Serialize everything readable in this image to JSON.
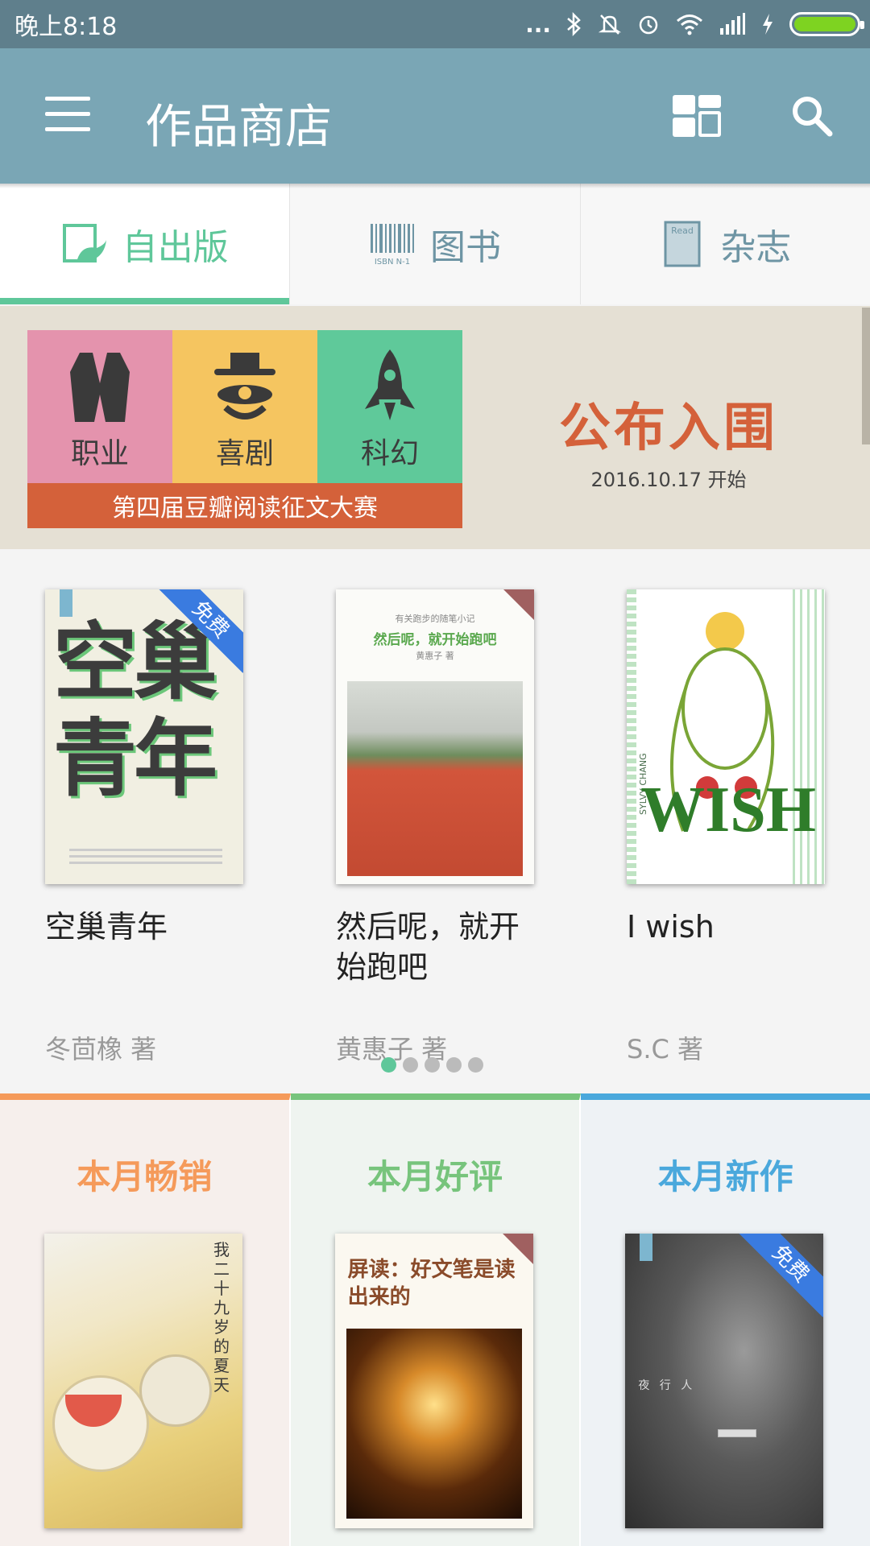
{
  "status_bar": {
    "time": "晚上8:18",
    "dots": "...",
    "wifi_icon": "wifi-icon",
    "battery_color": "#7ed321"
  },
  "app_bar": {
    "title": "作品商店",
    "menu_icon": "menu-icon",
    "layout_icon": "grid-layout-icon",
    "search_icon": "search-icon"
  },
  "tabs": [
    {
      "label": "自出版",
      "icon": "self-publish-icon",
      "active": true
    },
    {
      "label": "图书",
      "icon": "barcode-icon",
      "icon_text": "ISBN N-1"
    },
    {
      "label": "杂志",
      "icon": "magazine-icon",
      "icon_text": "Read"
    }
  ],
  "banner": {
    "categories": [
      {
        "label": "职业",
        "color": "#e493ad",
        "icon": "vest-icon"
      },
      {
        "label": "喜剧",
        "color": "#f5c560",
        "icon": "clown-icon"
      },
      {
        "label": "科幻",
        "color": "#5fc99a",
        "icon": "rocket-icon"
      }
    ],
    "contest": "第四届豆瓣阅读征文大赛",
    "headline": "公布入围",
    "date": "2016.10.17 开始"
  },
  "featured_books": [
    {
      "title": "空巢青年",
      "author": "冬茴橡 著",
      "badge": "免费",
      "cover_text": "空巢青年"
    },
    {
      "title": "然后呢，就开始跑吧",
      "author": "黄惠子 著",
      "cover_text": "然后呢，就开始跑吧",
      "cover_sub": "有关跑步的随笔小记",
      "cover_author": "黄惠子 著"
    },
    {
      "title": "I wish",
      "author": "S.C 著",
      "cover_text": "WISH",
      "cover_side": "SYLVY CHANG"
    }
  ],
  "pager": {
    "count": 5,
    "active": 0
  },
  "monthly": [
    {
      "title": "本月畅销",
      "color": "#f59a5a",
      "bg": "#f6efec",
      "cover_text": "我二十九岁的夏天"
    },
    {
      "title": "本月好评",
      "color": "#77c47c",
      "bg": "#eff4f0",
      "cover_text": "屏读：好文笔是读出来的"
    },
    {
      "title": "本月新作",
      "color": "#4aa8dc",
      "bg": "#eef2f5",
      "badge": "免费",
      "cover_text": "夜 行 人"
    }
  ]
}
